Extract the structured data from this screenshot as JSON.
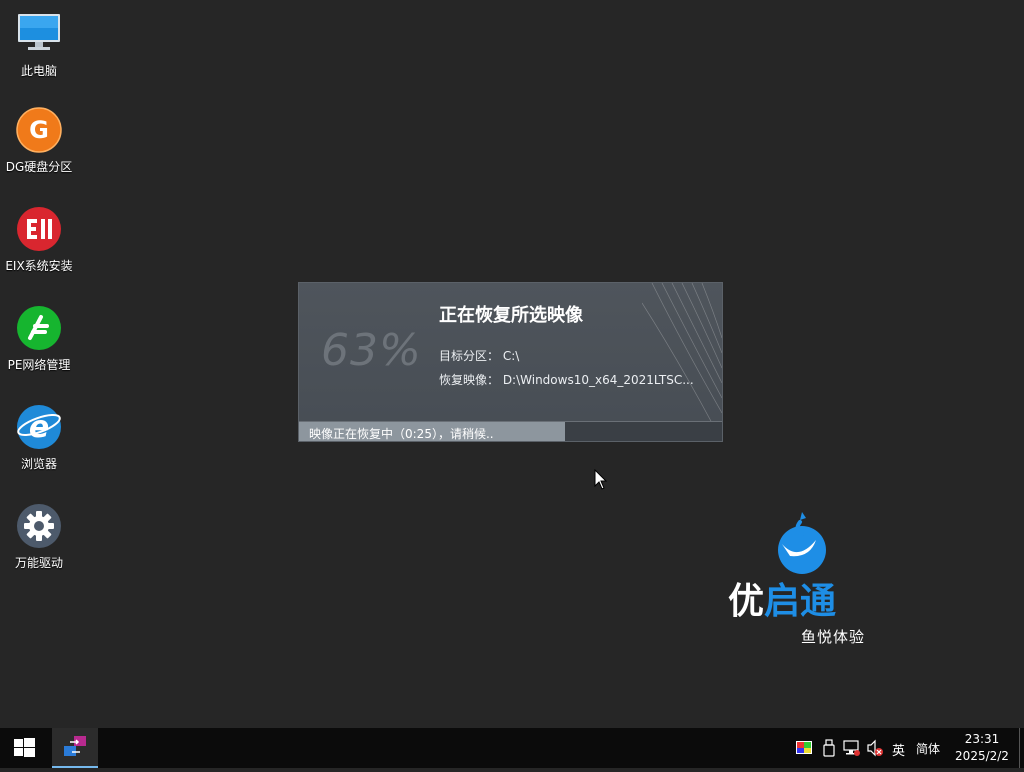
{
  "desktop": {
    "icons": [
      {
        "label": "此电脑",
        "icon": "computer-icon"
      },
      {
        "label": "DG硬盘分区",
        "icon": "diskgenius-icon"
      },
      {
        "label": "EIX系统安装",
        "icon": "eix-installer-icon"
      },
      {
        "label": "PE网络管理",
        "icon": "network-manager-icon"
      },
      {
        "label": "浏览器",
        "icon": "browser-icon"
      },
      {
        "label": "万能驱动",
        "icon": "driver-gear-icon"
      }
    ]
  },
  "dialog": {
    "percent_text": "63%",
    "title": "正在恢复所选映像",
    "target_partition": "目标分区： C:\\",
    "restore_image": "恢复映像： D:\\Windows10_x64_2021LTSC...",
    "progress_text": "映像正在恢复中（0:25），请稍候..",
    "progress_fraction": 0.63
  },
  "brand": {
    "name_part1": "优",
    "name_part2": "启通",
    "slogan": "鱼悦体验",
    "colors": {
      "primary": "#1e8ee6",
      "text": "#ffffff"
    }
  },
  "taskbar": {
    "start_icon": "windows-start-icon",
    "running_app_icon": "app-switcher-icon",
    "tray": {
      "ime_lang": "英",
      "ime_mode": "简体"
    },
    "clock": {
      "time": "23:31",
      "date": "2025/2/2"
    }
  },
  "colors": {
    "desktop_bg": "#262626",
    "taskbar_bg": "#0b0b0b",
    "progress_fill": "#8d969e",
    "dialog_bg": "#4d535a"
  }
}
